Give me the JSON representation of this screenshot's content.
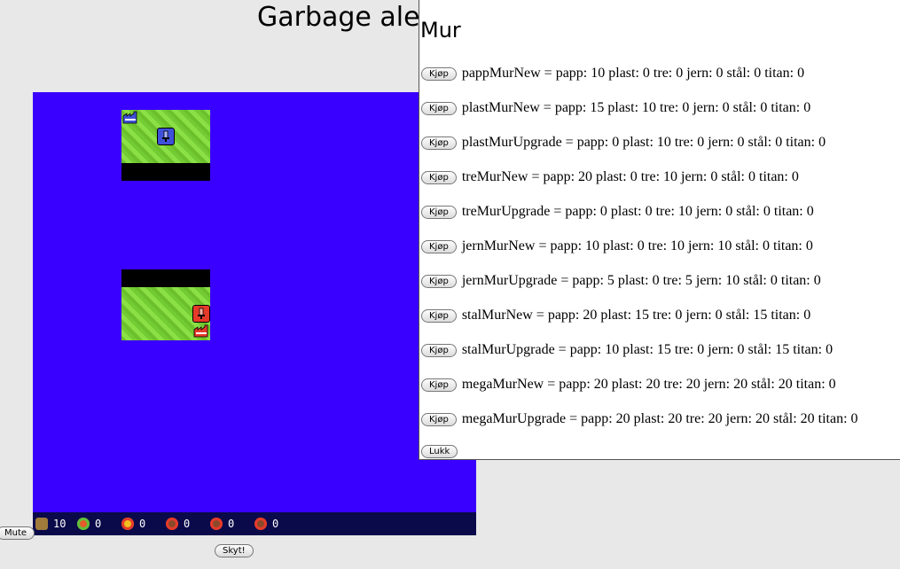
{
  "page": {
    "title": "Garbage alert"
  },
  "controls": {
    "mute_label": "Mute",
    "shoot_label": "Skyt!"
  },
  "status": {
    "items": [
      {
        "icon": "papp-icon",
        "value": "10"
      },
      {
        "icon": "plast-icon",
        "value": "0"
      },
      {
        "icon": "tre-icon",
        "value": "0"
      },
      {
        "icon": "jern-icon",
        "value": "0"
      },
      {
        "icon": "stal-icon",
        "value": "0"
      },
      {
        "icon": "titan-icon",
        "value": "0"
      }
    ]
  },
  "board": {
    "background_color": "#3a00ff",
    "player_color": "#3f51d8",
    "enemy_color": "#e53a2a"
  },
  "panel": {
    "title": "Mur",
    "buy_label": "Kjøp",
    "close_label": "Lukk",
    "items": [
      "pappMurNew = papp: 10 plast: 0 tre: 0 jern: 0 stål: 0 titan: 0",
      "plastMurNew = papp: 15 plast: 10 tre: 0 jern: 0 stål: 0 titan: 0",
      "plastMurUpgrade = papp: 0 plast: 10 tre: 0 jern: 0 stål: 0 titan: 0",
      "treMurNew = papp: 20 plast: 0 tre: 10 jern: 0 stål: 0 titan: 0",
      "treMurUpgrade = papp: 0 plast: 0 tre: 10 jern: 0 stål: 0 titan: 0",
      "jernMurNew = papp: 10 plast: 0 tre: 10 jern: 10 stål: 0 titan: 0",
      "jernMurUpgrade = papp: 5 plast: 0 tre: 5 jern: 10 stål: 0 titan: 0",
      "stalMurNew = papp: 20 plast: 15 tre: 0 jern: 0 stål: 15 titan: 0",
      "stalMurUpgrade = papp: 10 plast: 15 tre: 0 jern: 0 stål: 15 titan: 0",
      "megaMurNew = papp: 20 plast: 20 tre: 20 jern: 20 stål: 20 titan: 0",
      "megaMurUpgrade = papp: 20 plast: 20 tre: 20 jern: 20 stål: 20 titan: 0"
    ]
  }
}
